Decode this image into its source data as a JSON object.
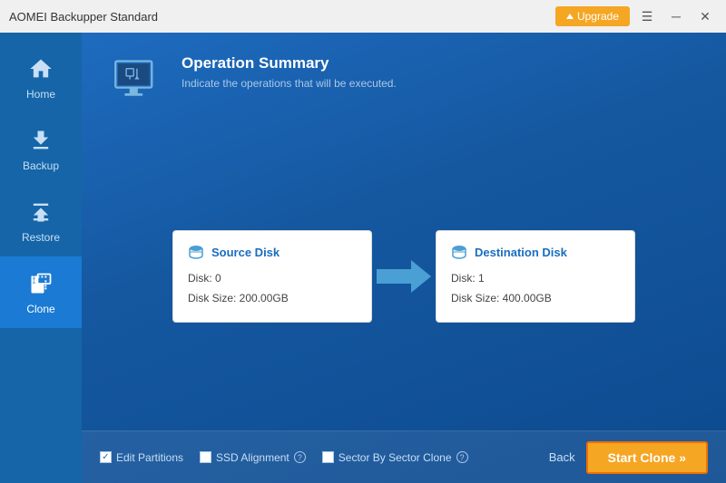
{
  "titlebar": {
    "title": "AOMEI Backupper Standard",
    "upgrade_label": "Upgrade"
  },
  "sidebar": {
    "items": [
      {
        "id": "home",
        "label": "Home",
        "active": false
      },
      {
        "id": "backup",
        "label": "Backup",
        "active": false
      },
      {
        "id": "restore",
        "label": "Restore",
        "active": false
      },
      {
        "id": "clone",
        "label": "Clone",
        "active": true
      }
    ]
  },
  "header": {
    "title": "Operation Summary",
    "subtitle": "Indicate the operations that will be executed."
  },
  "source_disk": {
    "title": "Source Disk",
    "disk_number": "Disk: 0",
    "disk_size": "Disk Size: 200.00GB"
  },
  "destination_disk": {
    "title": "Destination Disk",
    "disk_number": "Disk: 1",
    "disk_size": "Disk Size: 400.00GB"
  },
  "options": {
    "edit_partitions_label": "Edit Partitions",
    "ssd_alignment_label": "SSD Alignment",
    "sector_clone_label": "Sector By Sector Clone",
    "edit_partitions_checked": true,
    "ssd_alignment_checked": false,
    "sector_clone_checked": false
  },
  "buttons": {
    "back_label": "Back",
    "start_clone_label": "Start Clone »"
  }
}
